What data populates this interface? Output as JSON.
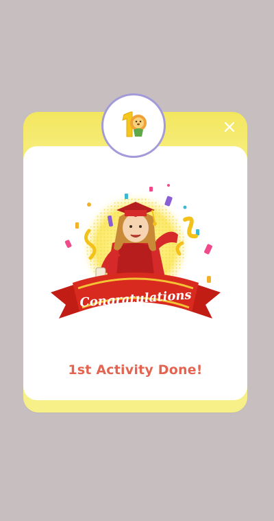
{
  "dialog": {
    "badge_icon": "number-one-lion-icon",
    "close_icon": "close-icon",
    "banner_text": "Congratulations",
    "message": "1st Activity Done!"
  },
  "colors": {
    "backdrop": "#c7bfbf",
    "frame_yellow": "#f6ec78",
    "badge_border": "#a39bd9",
    "message_red": "#e36451",
    "ribbon_red": "#d4261c"
  }
}
